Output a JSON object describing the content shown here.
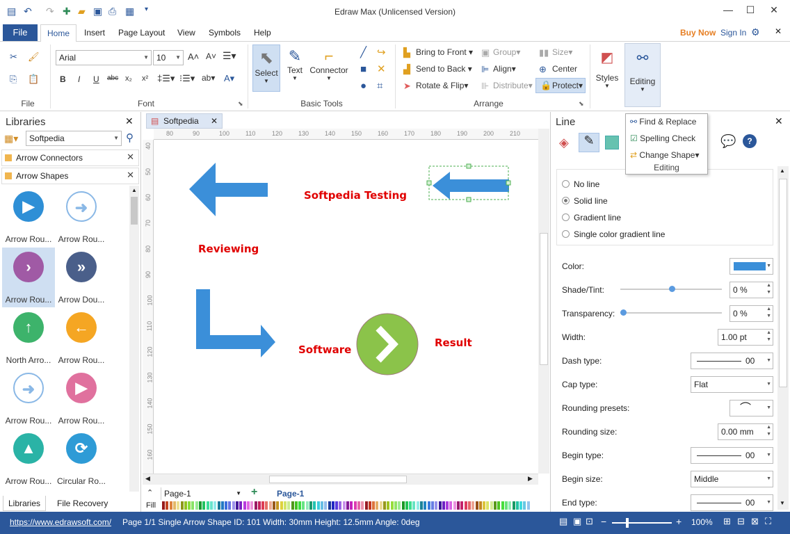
{
  "titlebar": {
    "title": "Edraw Max (Unlicensed Version)"
  },
  "menu": {
    "file": "File",
    "tabs": [
      "Home",
      "Insert",
      "Page Layout",
      "View",
      "Symbols",
      "Help"
    ],
    "buy_now": "Buy Now",
    "sign_in": "Sign In"
  },
  "ribbon": {
    "groups": {
      "file": "File",
      "font": "Font",
      "basic_tools": "Basic Tools",
      "arrange": "Arrange"
    },
    "font_name": "Arial",
    "font_size": "10",
    "select": "Select",
    "text": "Text",
    "connector": "Connector",
    "bring_to_front": "Bring to Front",
    "send_to_back": "Send to Back",
    "rotate_flip": "Rotate & Flip",
    "group": "Group",
    "align": "Align",
    "distribute": "Distribute",
    "size": "Size",
    "center": "Center",
    "protect": "Protect",
    "styles": "Styles",
    "editing": "Editing"
  },
  "editing_popup": {
    "find_replace": "Find & Replace",
    "spelling_check": "Spelling Check",
    "change_shape": "Change Shape",
    "label": "Editing"
  },
  "libraries": {
    "title": "Libraries",
    "combo": "Softpedia",
    "sections": [
      "Arrow Connectors",
      "Arrow Shapes"
    ],
    "shapes": [
      {
        "label": "Arrow Rou...",
        "color": "#2e8fd6",
        "glyph": "▶"
      },
      {
        "label": "Arrow Rou...",
        "color": "#ffffff",
        "glyph": "➜"
      },
      {
        "label": "Arrow Rou...",
        "color": "#a05aa5",
        "glyph": "›"
      },
      {
        "label": "Arrow Dou...",
        "color": "#4a5f8a",
        "glyph": "»"
      },
      {
        "label": "North Arro...",
        "color": "#3db36b",
        "glyph": "↑"
      },
      {
        "label": "Arrow Rou...",
        "color": "#f5a623",
        "glyph": "←"
      },
      {
        "label": "Arrow Rou...",
        "color": "#ffffff",
        "glyph": "➜"
      },
      {
        "label": "Arrow Rou...",
        "color": "#e0719e",
        "glyph": "▶"
      },
      {
        "label": "Arrow Rou...",
        "color": "#2ab3a6",
        "glyph": "▲"
      },
      {
        "label": "Circular Ro...",
        "color": "#2e9bd6",
        "glyph": "⟳"
      }
    ],
    "tab_libraries": "Libraries",
    "tab_recovery": "File Recovery"
  },
  "canvas": {
    "doc_tab": "Softpedia",
    "ruler_h": [
      "80",
      "90",
      "100",
      "110",
      "120",
      "130",
      "140",
      "150",
      "160",
      "170",
      "180",
      "190",
      "200",
      "210"
    ],
    "ruler_v": [
      "40",
      "50",
      "60",
      "70",
      "80",
      "90",
      "100",
      "110",
      "120",
      "130",
      "140",
      "150",
      "160"
    ],
    "texts": {
      "softpedia_testing": "Softpedia Testing",
      "reviewing": "Reviewing",
      "software": "Software",
      "result": "Result"
    },
    "page_select": "Page-1",
    "page_tab": "Page-1",
    "fill_label": "Fill"
  },
  "line_panel": {
    "title": "Line",
    "options": [
      "No line",
      "Solid line",
      "Gradient line",
      "Single color gradient line"
    ],
    "selected": "Solid line",
    "color_label": "Color:",
    "color_value": "#3b8fd9",
    "shade_label": "Shade/Tint:",
    "shade_value": "0 %",
    "transparency_label": "Transparency:",
    "transparency_value": "0 %",
    "width_label": "Width:",
    "width_value": "1.00 pt",
    "dash_label": "Dash type:",
    "dash_value": "00",
    "cap_label": "Cap type:",
    "cap_value": "Flat",
    "rounding_presets_label": "Rounding presets:",
    "rounding_size_label": "Rounding size:",
    "rounding_size_value": "0.00 mm",
    "begin_type_label": "Begin type:",
    "begin_type_value": "00",
    "begin_size_label": "Begin size:",
    "begin_size_value": "Middle",
    "end_type_label": "End type:",
    "end_type_value": "00"
  },
  "status": {
    "link": "https://www.edrawsoft.com/",
    "info": "Page 1/1  Single Arrow  Shape ID: 101  Width: 30mm  Height: 12.5mm  Angle: 0deg",
    "zoom": "100%"
  }
}
